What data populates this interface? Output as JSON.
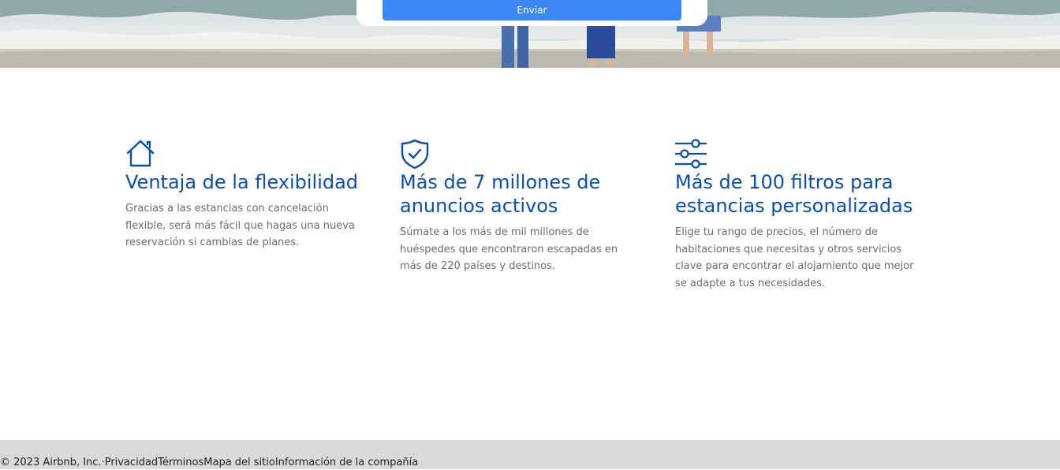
{
  "hero": {
    "image": "beach-family-photo",
    "submit_label": "Enviar"
  },
  "features": [
    {
      "icon": "house-icon",
      "title": "Ventaja de la flexibilidad",
      "description": "Gracias a las estancias con cancelación flexible, será más fácil que hagas una nueva reservación si cambias de planes."
    },
    {
      "icon": "shield-check-icon",
      "title": "Más de 7 millones de anuncios activos",
      "description": "Súmate a los más de mil millones de huéspedes que encontraron escapadas en más de 220 países y destinos."
    },
    {
      "icon": "sliders-icon",
      "title": "Más de 100 filtros para estancias personalizadas",
      "description": "Elige tu rango de precios, el número de habitaciones que necesitas y otros servicios clave para encontrar el alojamiento que mejor se adapte a tus necesidades."
    }
  ],
  "footer": {
    "copyright": "© 2023 Airbnb, Inc.",
    "separator": "·",
    "links": [
      "Privacidad",
      "Términos",
      "Mapa del sitio",
      "Información de la compañía"
    ]
  },
  "colors": {
    "accent": "#0b4fae",
    "button": "#3d88f7",
    "footer_bg": "#dadada",
    "body_text": "#6d6d6d"
  }
}
